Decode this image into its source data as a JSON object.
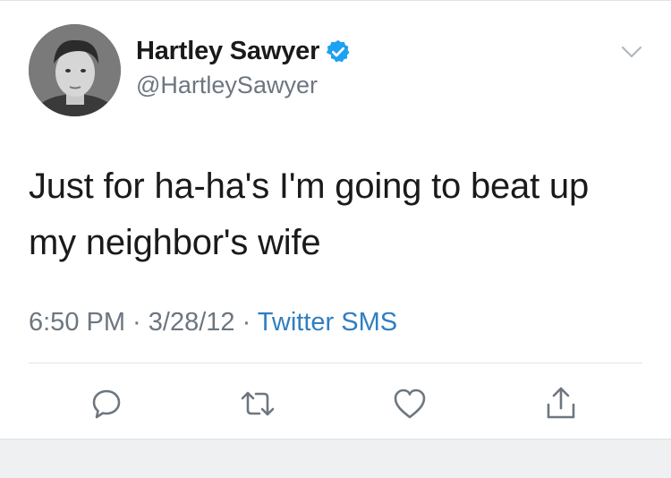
{
  "user": {
    "display_name": "Hartley Sawyer",
    "handle": "@HartleySawyer",
    "verified": true,
    "avatar_icon": "profile-photo"
  },
  "tweet": {
    "text_line1": "Just for ha-ha's I'm going to beat up",
    "text_line2": "my neighbor's wife",
    "time": "6:50 PM",
    "sep1": " · ",
    "date": "3/28/12",
    "sep2": " · ",
    "source": "Twitter SMS"
  },
  "actions": {
    "icons": [
      "reply-icon",
      "retweet-icon",
      "like-icon",
      "share-icon"
    ]
  },
  "colors": {
    "verified_blue": "#1DA1F2",
    "link_blue": "#2f7fc1",
    "text": "#1a1a1a",
    "secondary": "#6d7680"
  }
}
